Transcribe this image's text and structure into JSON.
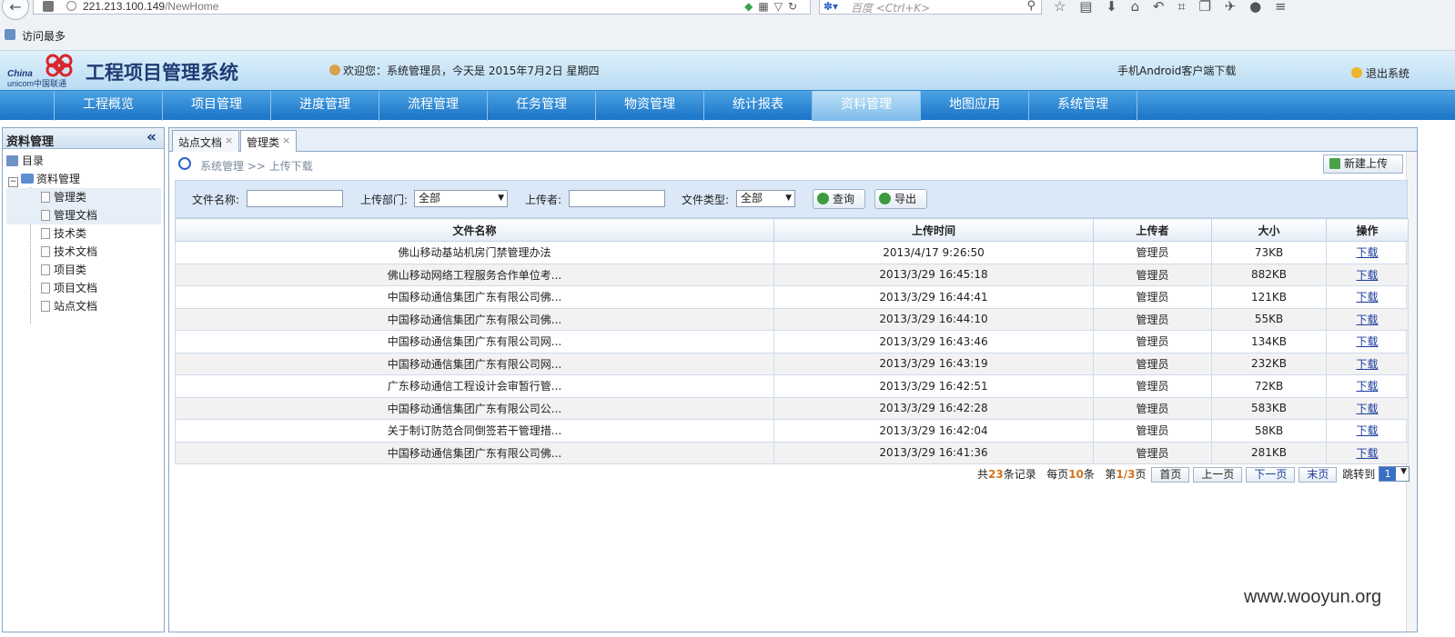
{
  "browser": {
    "url_host": "221.213.100.149",
    "url_path": "/NewHome",
    "search_placeholder": "百度 <Ctrl+K>",
    "bookmark_label": "访问最多"
  },
  "header": {
    "logo_text_line1": "China",
    "logo_text_line2": "unicom中国联通",
    "title": "工程项目管理系统",
    "welcome": "欢迎您：系统管理员，今天是 2015年7月2日 星期四",
    "android": "手机Android客户端下载",
    "logout": "退出系统"
  },
  "nav": {
    "items": [
      "工程概览",
      "项目管理",
      "进度管理",
      "流程管理",
      "任务管理",
      "物资管理",
      "统计报表",
      "资料管理",
      "地图应用",
      "系统管理"
    ],
    "active_index": 7
  },
  "sidebar": {
    "title": "资料管理",
    "collapse": "«",
    "root": "目录",
    "folder": "资料管理",
    "items": [
      "管理类",
      "管理文档",
      "技术类",
      "技术文档",
      "项目类",
      "项目文档",
      "站点文档"
    ]
  },
  "tabs": [
    {
      "label": "站点文档",
      "close": "×"
    },
    {
      "label": "管理类",
      "close": "×"
    }
  ],
  "breadcrumb": "系统管理 >> 上传下载",
  "new_upload_label": "新建上传",
  "filter": {
    "file_name_label": "文件名称:",
    "dept_label": "上传部门:",
    "dept_value": "全部",
    "uploader_label": "上传者:",
    "type_label": "文件类型:",
    "type_value": "全部",
    "query_label": "查询",
    "export_label": "导出"
  },
  "table": {
    "columns": [
      "文件名称",
      "上传时间",
      "上传者",
      "大小",
      "操作"
    ],
    "rows": [
      [
        "佛山移动基站机房门禁管理办法",
        "2013/4/17 9:26:50",
        "管理员",
        "73KB",
        "下载"
      ],
      [
        "佛山移动网络工程服务合作单位考...",
        "2013/3/29 16:45:18",
        "管理员",
        "882KB",
        "下载"
      ],
      [
        "中国移动通信集团广东有限公司佛...",
        "2013/3/29 16:44:41",
        "管理员",
        "121KB",
        "下载"
      ],
      [
        "中国移动通信集团广东有限公司佛...",
        "2013/3/29 16:44:10",
        "管理员",
        "55KB",
        "下载"
      ],
      [
        "中国移动通信集团广东有限公司网...",
        "2013/3/29 16:43:46",
        "管理员",
        "134KB",
        "下载"
      ],
      [
        "中国移动通信集团广东有限公司网...",
        "2013/3/29 16:43:19",
        "管理员",
        "232KB",
        "下载"
      ],
      [
        "广东移动通信工程设计会审暂行管...",
        "2013/3/29 16:42:51",
        "管理员",
        "72KB",
        "下载"
      ],
      [
        "中国移动通信集团广东有限公司公...",
        "2013/3/29 16:42:28",
        "管理员",
        "583KB",
        "下载"
      ],
      [
        "关于制订防范合同倒签若干管理措...",
        "2013/3/29 16:42:04",
        "管理员",
        "58KB",
        "下载"
      ],
      [
        "中国移动通信集团广东有限公司佛...",
        "2013/3/29 16:41:36",
        "管理员",
        "281KB",
        "下载"
      ]
    ]
  },
  "pager": {
    "total_prefix": "共",
    "total": "23",
    "total_suffix": "条记录",
    "per_prefix": "每页",
    "per": "10",
    "per_suffix": "条",
    "page_prefix": "第",
    "page": "1/3",
    "page_suffix": "页",
    "first": "首页",
    "prev": "上一页",
    "next": "下一页",
    "last": "末页",
    "jump": "跳转到",
    "jump_value": "1"
  },
  "watermark": "www.wooyun.org"
}
